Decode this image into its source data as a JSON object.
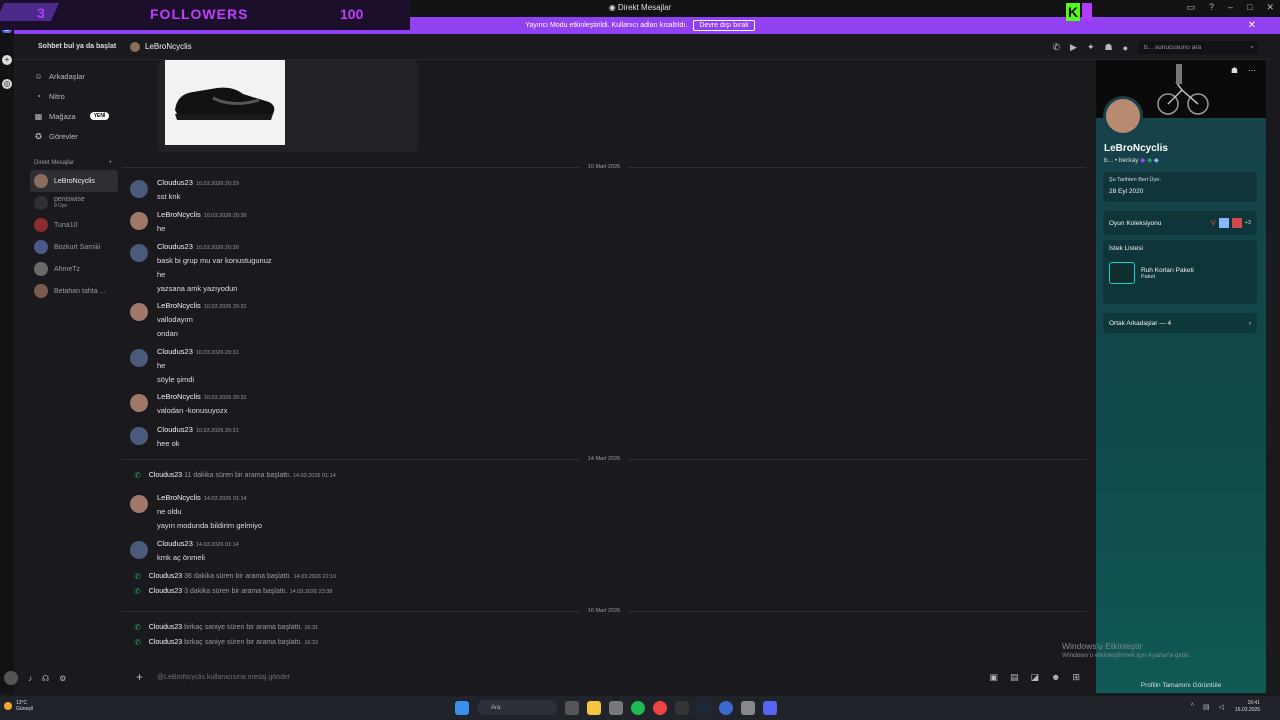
{
  "overlay": {
    "count_left": "3",
    "label": "FOLLOWERS",
    "count": "100"
  },
  "window": {
    "title": "Direkt Mesajlar"
  },
  "banner": {
    "text": "Yayıncı Modu etkinleştirildi. Kullanıcı adları kısaltıldı.",
    "button": "Devre dışı bırak"
  },
  "sidebar": {
    "search": "Sohbet bul ya da başlat",
    "nav": [
      {
        "label": "Arkadaşlar",
        "icon": "friends-icon"
      },
      {
        "label": "Nitro",
        "icon": "nitro-icon"
      },
      {
        "label": "Mağaza",
        "icon": "shop-icon",
        "badge": "YENİ"
      },
      {
        "label": "Görevler",
        "icon": "quests-icon"
      }
    ],
    "dm_header": "Direkt Mesajlar",
    "dms": [
      {
        "name": "LeBroNcyclis",
        "active": true,
        "avatar": "#8a6b5c"
      },
      {
        "name": "peniswise",
        "sub": "9 Üye",
        "avatar": "#2f2f34"
      },
      {
        "name": "Tuna10",
        "avatar": "#8b2d2d"
      },
      {
        "name": "Bozkurt Samiiii",
        "avatar": "#4a5a8a"
      },
      {
        "name": "AhmeTz",
        "avatar": "#6a6a6a"
      },
      {
        "name": "Betahan tahta ...",
        "avatar": "#7a5a4a"
      }
    ]
  },
  "header": {
    "name": "LeBroNcyclis",
    "search_placeholder": "b... sunucusunu ara"
  },
  "messages": {
    "days": [
      "10 Mart 2026",
      "14 Mart 2026",
      "16 Mart 2026"
    ],
    "items": [
      {
        "author": "Cloudus23",
        "time": "10.03.2026 20:29",
        "lines": [
          "sst knk"
        ]
      },
      {
        "author": "LeBroNcyclis",
        "time": "10.03.2026 20:30",
        "lines": [
          "he"
        ]
      },
      {
        "author": "Cloudus23",
        "time": "10.03.2026 20:30",
        "lines": [
          "bask bi grup mu var konustugunuz",
          "he",
          "yazsana amk yazıyodun"
        ]
      },
      {
        "author": "LeBroNcyclis",
        "time": "10.03.2026 20:31",
        "lines": [
          "vallodayım",
          "ondan"
        ]
      },
      {
        "author": "Cloudus23",
        "time": "10.03.2026 20:31",
        "lines": [
          "he",
          "söyle şimdi"
        ]
      },
      {
        "author": "LeBroNcyclis",
        "time": "10.03.2026 20:31",
        "lines": [
          "valodan -konusuyozx"
        ]
      },
      {
        "author": "Cloudus23",
        "time": "10.03.2026 20:31",
        "lines": [
          "hee ok"
        ]
      },
      {
        "author": "LeBroNcyclis",
        "time": "14.03.2026 01:14",
        "lines": [
          "ne oldu",
          "yayın modunda bildirim gelmiyo"
        ]
      },
      {
        "author": "Cloudus23",
        "time": "14.03.2026 01:14",
        "lines": [
          "kmk aç önmeli"
        ]
      }
    ],
    "calls": [
      {
        "author": "Cloudus23",
        "text": " 11 dakika süren bir arama başlattı.",
        "time": "14.03.2026 01:14"
      },
      {
        "author": "Cloudus23",
        "text": " 36 dakika süren bir arama başlattı.",
        "time": "14.03.2026 22:10"
      },
      {
        "author": "Cloudus23",
        "text": " 3 dakika süren bir arama başlattı.",
        "time": "14.03.2026 23:38"
      },
      {
        "author": "Cloudus23",
        "text": " birkaç saniye süren bir arama başlattı.",
        "time": "16:31"
      },
      {
        "author": "Cloudus23",
        "text": " birkaç saniye süren bir arama başlattı.",
        "time": "16:32"
      }
    ]
  },
  "input": {
    "placeholder": "@LeBroNcyclis kullanıcısına mesaj gönder"
  },
  "profile": {
    "name": "LeBroNcyclis",
    "tag": "b... • berkay",
    "member_since_label": "Şu Tarihten Beri Üye:",
    "member_since": "28 Eyl 2020",
    "games_label": "Oyun Koleksiyonu",
    "games_more": "+3",
    "wishlist_label": "İstek Listesi",
    "wish_title": "Ruh Korları Paketi",
    "wish_sub": "Paket",
    "mutual_friends": "Ortak Arkadaşlar — 4",
    "view_full": "Profilin Tamamını Görüntüle"
  },
  "activation": {
    "title": "Windows'u Etkinleştir",
    "sub": "Windows'u etkinleştirmek için Ayarlar'a gidin."
  },
  "taskbar": {
    "temp": "13°C",
    "weather": "Güneşli",
    "search": "Ara",
    "time": "16:41",
    "date": "16.03.2026"
  },
  "colors": {
    "accent": "#9140f2",
    "bg": "#1a1a1e",
    "call": "#23a55a",
    "profile": "#0f4a4a"
  }
}
